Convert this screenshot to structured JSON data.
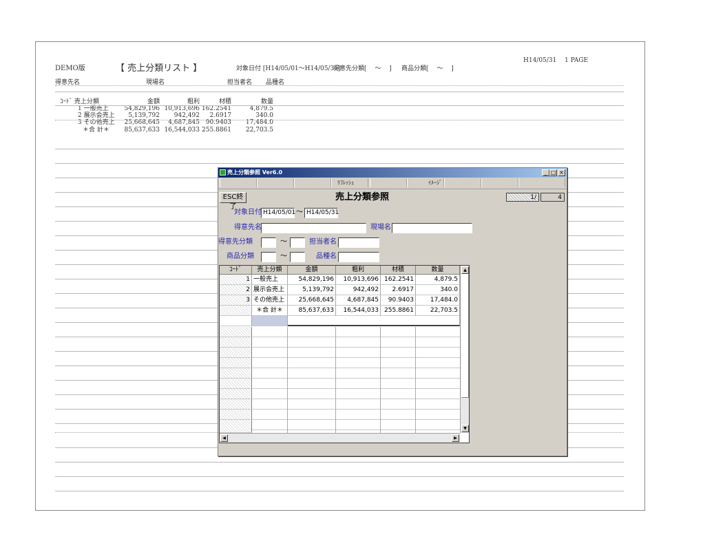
{
  "report": {
    "demo_label": "DEMO版",
    "title": "【 売上分類リスト 】",
    "date_line": "対象日付 [H14/05/01～H14/05/31]",
    "cust_class_line": "得意先分類[　 ～　 ]",
    "prod_class_line": "商品分類[　 ～　 ]",
    "print_date": "H14/05/31",
    "page_label": "1 PAGE",
    "header": {
      "customer": "得意先名",
      "site": "現場名",
      "staff": "担当者名",
      "item": "品種名"
    },
    "columns": [
      "ｺｰﾄﾞ 売上分類",
      "金額",
      "粗利",
      "材積",
      "数量"
    ],
    "rows": [
      {
        "code_name": "1 一般売上",
        "amount": "54,829,196",
        "profit": "10,913,696",
        "volume": "162.2541",
        "qty": "4,879.5"
      },
      {
        "code_name": "2 展示会売上",
        "amount": "5,139,792",
        "profit": "942,492",
        "volume": "2.6917",
        "qty": "340.0"
      },
      {
        "code_name": "3 その他売上",
        "amount": "25,668,645",
        "profit": "4,687,845",
        "volume": "90.9403",
        "qty": "17,484.0"
      },
      {
        "code_name": "＊合 計＊",
        "amount": "85,637,633",
        "profit": "16,544,033",
        "volume": "255.8861",
        "qty": "22,703.5"
      }
    ]
  },
  "dialog": {
    "window_title": "売上分類参照 Ver6.0",
    "toolbar": {
      "refresh": "ﾘﾌﾚｯｼｭ",
      "image": "ｲﾒｰｼﾞ"
    },
    "esc_button": "ESC終了",
    "heading": "売上分類参照",
    "page_current": "1/",
    "page_total": "4",
    "labels": {
      "date": "対象日付",
      "customer": "得意先名",
      "site": "現場名",
      "cust_class": "得意先分類",
      "staff": "担当者名",
      "prod_class": "商品分類",
      "item": "品種名",
      "tilde": "～"
    },
    "values": {
      "date_from": "H14/05/01",
      "date_to": "H14/05/31",
      "customer": "",
      "site": "",
      "cust_class_from": "",
      "cust_class_to": "",
      "staff": "",
      "prod_class_from": "",
      "prod_class_to": "",
      "item": ""
    },
    "grid": {
      "headers": [
        "ｺｰﾄﾞ",
        "売上分類",
        "金額",
        "粗利",
        "材積",
        "数量"
      ],
      "rows": [
        {
          "code": "1",
          "name": "一般売上",
          "amount": "54,829,196",
          "profit": "10,913,696",
          "volume": "162.2541",
          "qty": "4,879.5"
        },
        {
          "code": "2",
          "name": "展示会売上",
          "amount": "5,139,792",
          "profit": "942,492",
          "volume": "2.6917",
          "qty": "340.0"
        },
        {
          "code": "3",
          "name": "その他売上",
          "amount": "25,668,645",
          "profit": "4,687,845",
          "volume": "90.9403",
          "qty": "17,484.0"
        },
        {
          "code": "",
          "name": "＊合 計＊",
          "amount": "85,637,633",
          "profit": "16,544,033",
          "volume": "255.8861",
          "qty": "22,703.5"
        }
      ]
    }
  }
}
